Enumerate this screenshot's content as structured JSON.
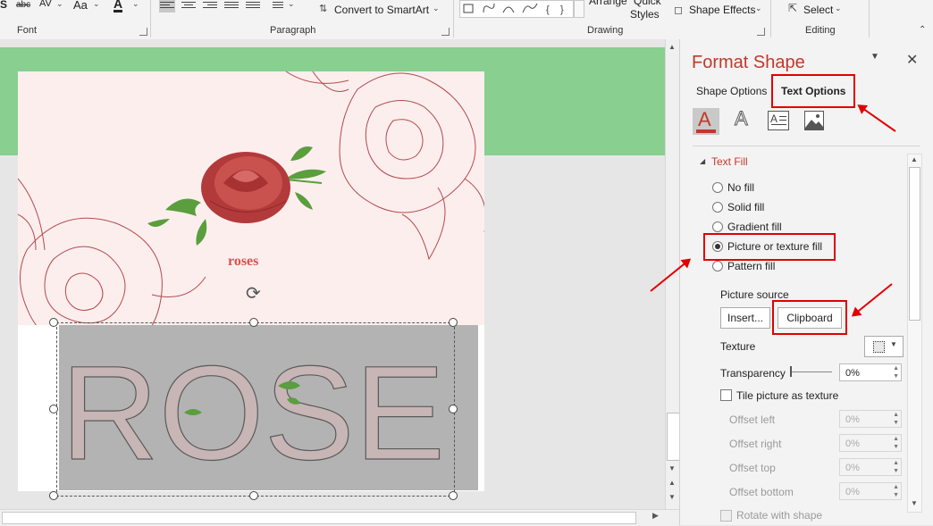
{
  "ribbon": {
    "groups": [
      {
        "label": "Font"
      },
      {
        "label": "Paragraph"
      },
      {
        "label": "Drawing"
      },
      {
        "label": "Editing"
      }
    ],
    "convert_smartart": "Convert to SmartArt",
    "arrange": "Arrange",
    "quick_styles_1": "Quick",
    "quick_styles_2": "Styles",
    "shape_effects": "Shape Effects",
    "select": "Select",
    "font_size_glyph": "Aa",
    "strike_glyph": "abc",
    "spacing_glyph": "AV",
    "font_color_glyph": "A"
  },
  "slide": {
    "small_title": "roses",
    "big_word": "ROSE"
  },
  "pane": {
    "title": "Format Shape",
    "tabs": [
      {
        "label": "Shape Options",
        "active": false
      },
      {
        "label": "Text Options",
        "active": true
      }
    ],
    "section_title": "Text Fill",
    "fill_options": [
      {
        "label": "No fill",
        "selected": false
      },
      {
        "label": "Solid fill",
        "selected": false
      },
      {
        "label": "Gradient fill",
        "selected": false
      },
      {
        "label": "Picture or texture fill",
        "selected": true
      },
      {
        "label": "Pattern fill",
        "selected": false
      }
    ],
    "picture_source_label": "Picture source",
    "insert_button": "Insert...",
    "clipboard_button": "Clipboard",
    "texture_label": "Texture",
    "transparency_label": "Transparency",
    "transparency_value": "0%",
    "tile_label": "Tile picture as texture",
    "offsets": [
      {
        "label": "Offset left",
        "value": "0%"
      },
      {
        "label": "Offset right",
        "value": "0%"
      },
      {
        "label": "Offset top",
        "value": "0%"
      },
      {
        "label": "Offset bottom",
        "value": "0%"
      }
    ],
    "rotate_label": "Rotate with shape"
  },
  "colors": {
    "accent_red": "#c0392b",
    "highlight_red": "#e00000",
    "green_bar": "#88cf90"
  }
}
